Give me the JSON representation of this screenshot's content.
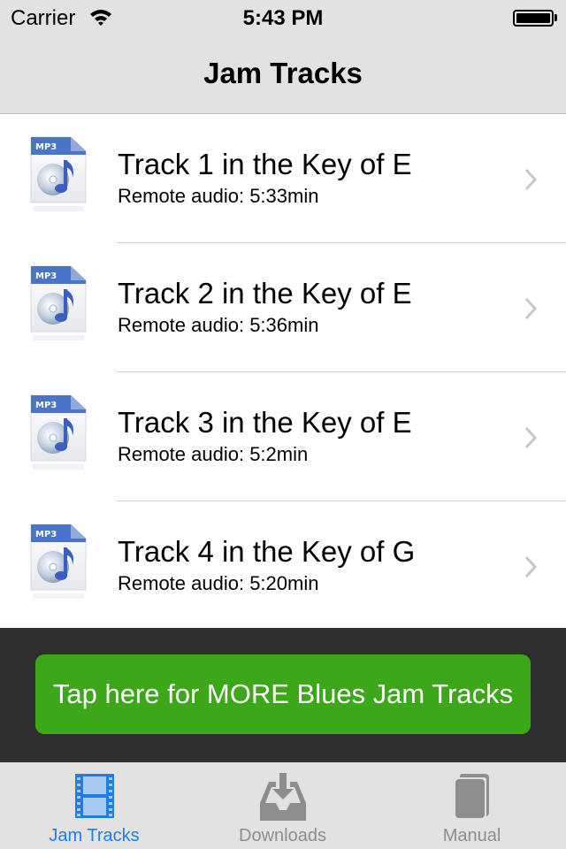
{
  "status_bar": {
    "carrier": "Carrier",
    "time": "5:43 PM",
    "wifi_icon": "wifi-icon",
    "battery_icon": "battery-full-icon"
  },
  "nav": {
    "title": "Jam Tracks"
  },
  "tracks": [
    {
      "title": "Track 1 in the Key of E",
      "subtitle": "Remote audio: 5:33min",
      "icon": "mp3-file-icon"
    },
    {
      "title": "Track 2 in the Key of E",
      "subtitle": "Remote audio: 5:36min",
      "icon": "mp3-file-icon"
    },
    {
      "title": "Track 3 in the Key of E",
      "subtitle": "Remote audio: 5:2min",
      "icon": "mp3-file-icon"
    },
    {
      "title": "Track 4 in the Key of G",
      "subtitle": "Remote audio: 5:20min",
      "icon": "mp3-file-icon"
    }
  ],
  "icon_labels": {
    "mp3": "MP3"
  },
  "promo": {
    "label": "Tap here for MORE Blues Jam Tracks",
    "color": "#3ca819"
  },
  "tab_bar": {
    "active_color": "#1f7ee6",
    "inactive_color": "#8e8e8e",
    "tabs": [
      {
        "label": "Jam Tracks",
        "icon": "film-strip-icon",
        "active": true
      },
      {
        "label": "Downloads",
        "icon": "download-tray-icon",
        "active": false
      },
      {
        "label": "Manual",
        "icon": "book-icon",
        "active": false
      }
    ]
  }
}
